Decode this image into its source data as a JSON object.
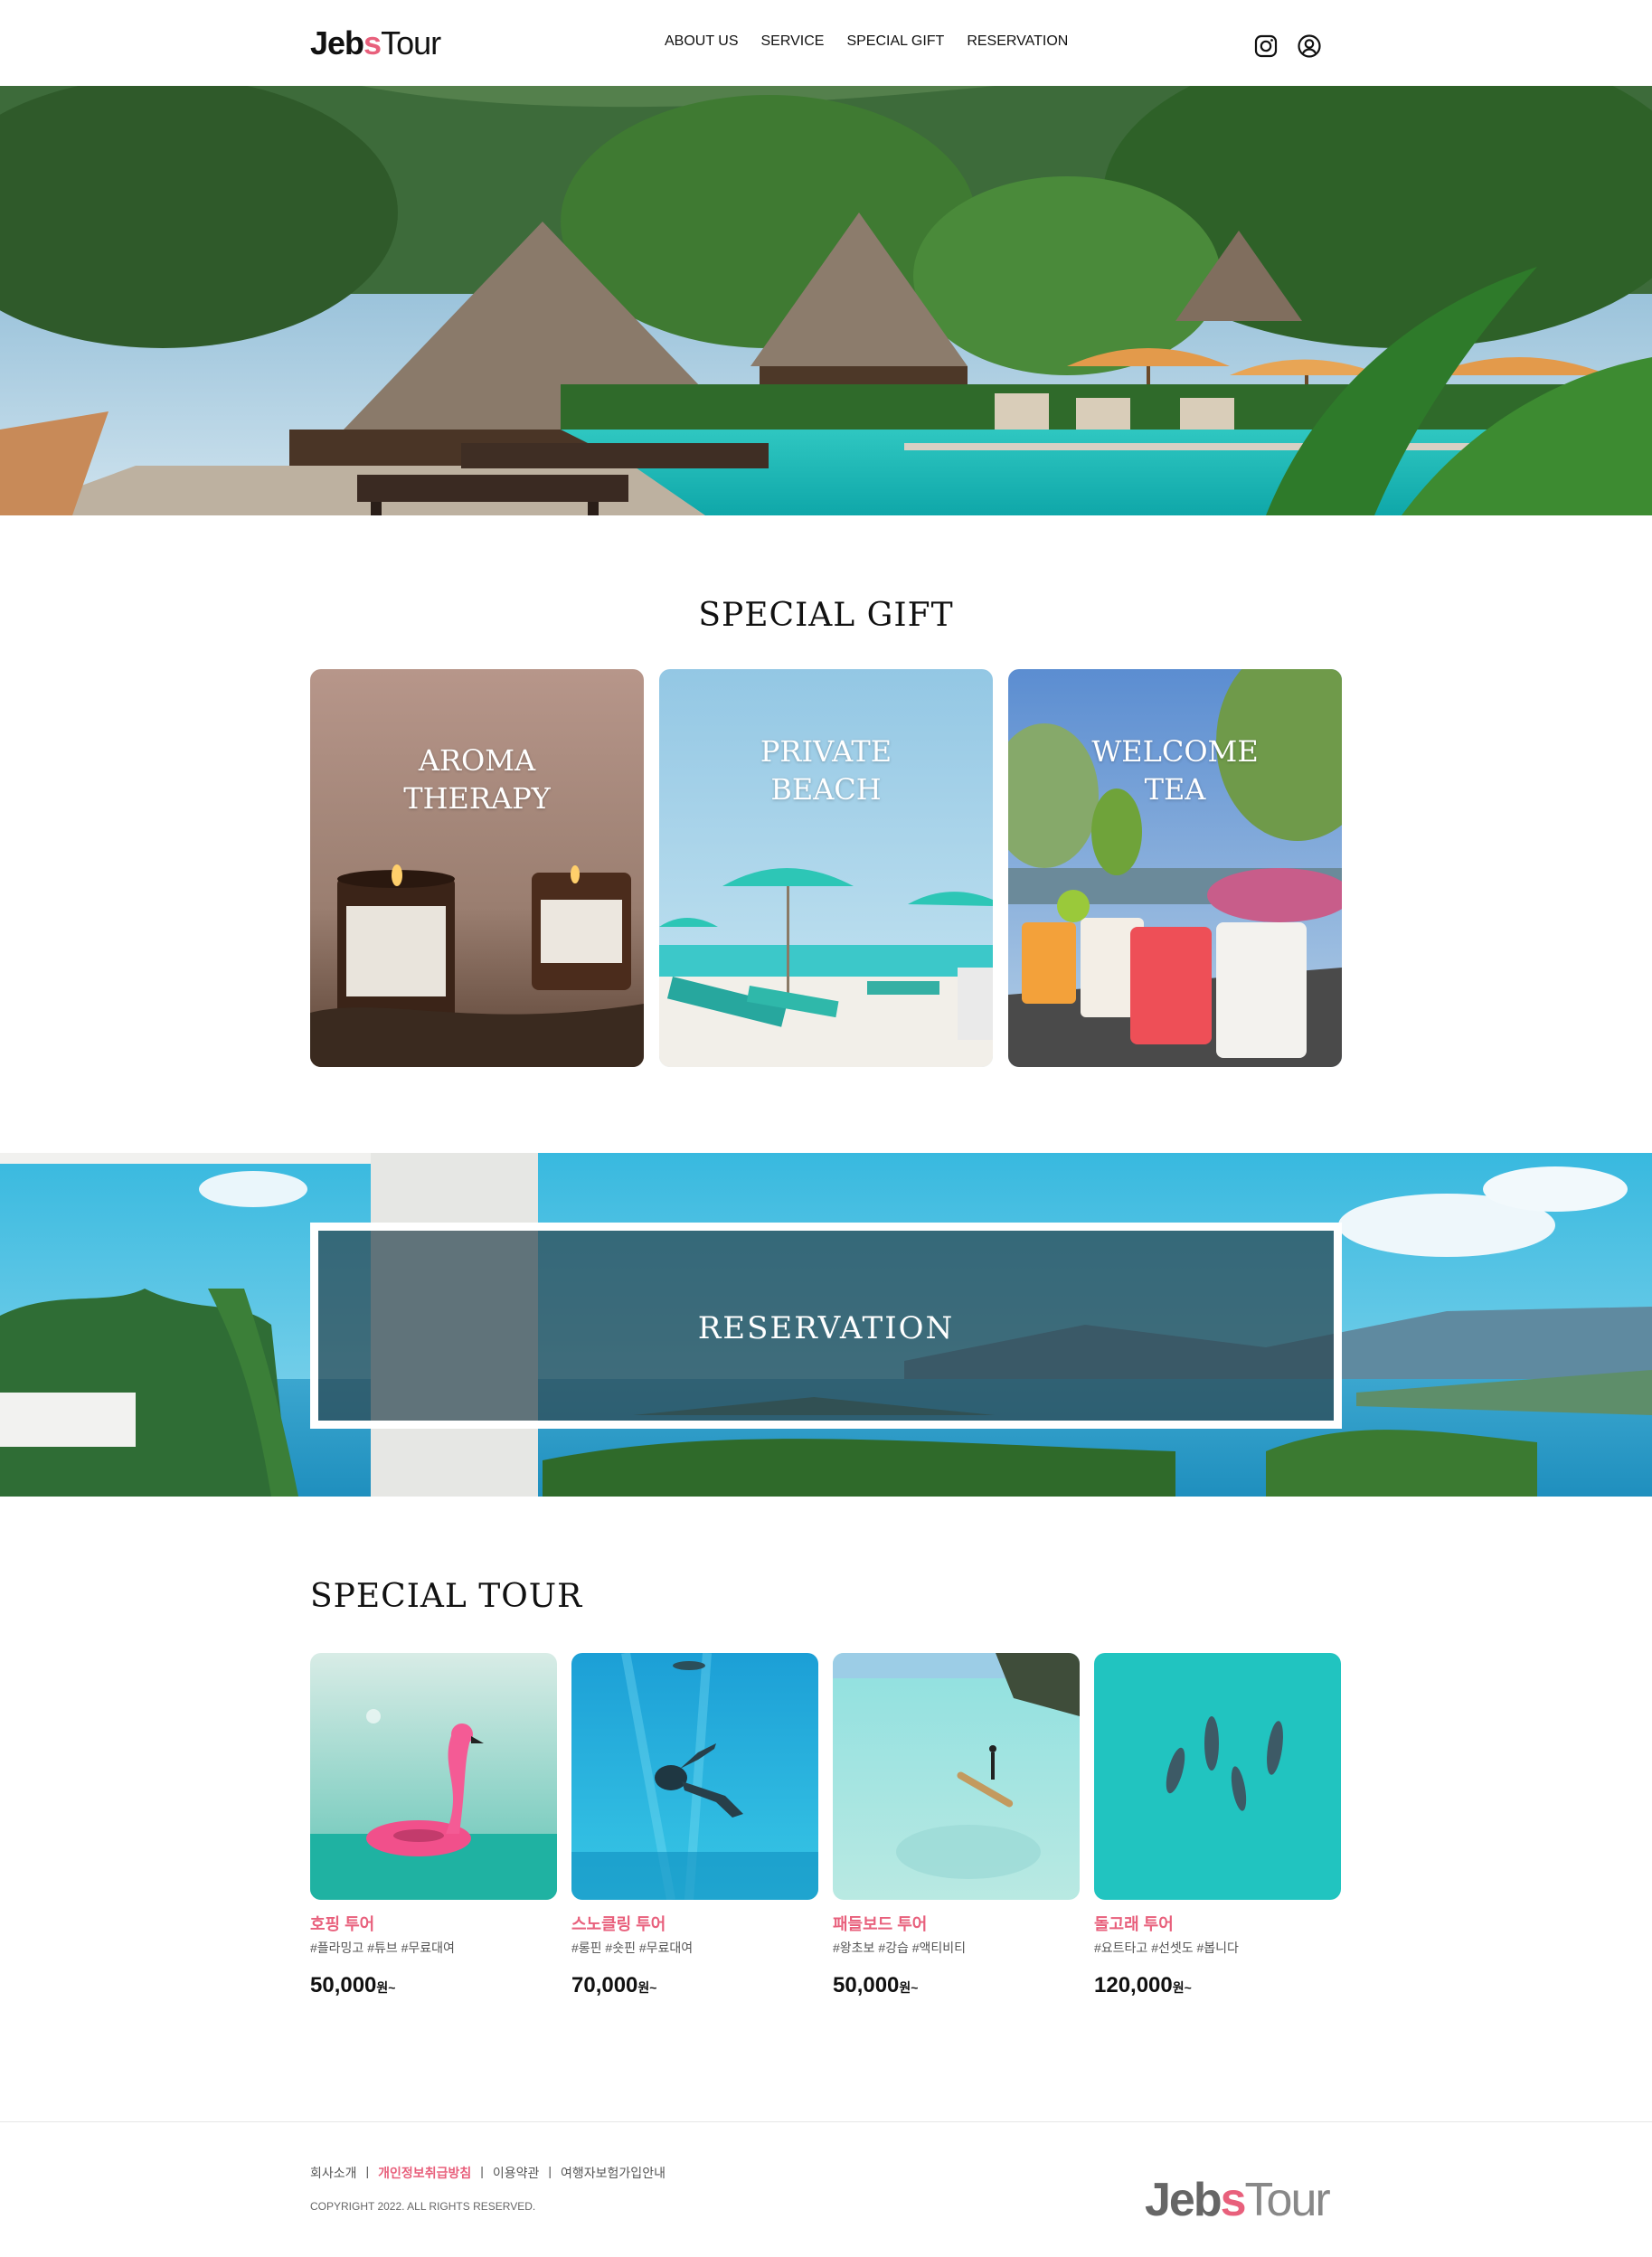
{
  "header": {
    "logo": {
      "part1": "Jeb",
      "part2": "s",
      "part3": "Tour"
    },
    "nav": [
      "ABOUT US",
      "SERVICE",
      "SPECIAL GIFT",
      "RESERVATION"
    ]
  },
  "special_gift": {
    "title": "SPECIAL GIFT",
    "cards": [
      {
        "title": "AROMA\nTHERAPY"
      },
      {
        "title": "PRIVATE\nBEACH"
      },
      {
        "title": "WELCOME\nTEA"
      }
    ]
  },
  "reservation": {
    "label": "RESERVATION"
  },
  "special_tour": {
    "title": "SPECIAL TOUR",
    "items": [
      {
        "name": "호핑 투어",
        "tags": "#플라밍고 #튜브 #무료대여",
        "price": "50,000",
        "unit": "원~"
      },
      {
        "name": "스노클링 투어",
        "tags": "#롱핀 #숏핀 #무료대여",
        "price": "70,000",
        "unit": "원~"
      },
      {
        "name": "패들보드 투어",
        "tags": "#왕초보 #강습 #액티비티",
        "price": "50,000",
        "unit": "원~"
      },
      {
        "name": "돌고래 투어",
        "tags": "#요트타고 #선셋도 #봅니다",
        "price": "120,000",
        "unit": "원~"
      }
    ]
  },
  "footer": {
    "links": [
      "회사소개",
      "개인정보취급방침",
      "이용약관",
      "여행자보험가입안내"
    ],
    "separator": "|",
    "copyright": "COPYRIGHT 2022. ALL RIGHTS RESERVED.",
    "logo": {
      "part1": "Jeb",
      "part2": "s",
      "part3": "Tour"
    }
  },
  "colors": {
    "accent": "#e8607c",
    "text": "#111111"
  }
}
